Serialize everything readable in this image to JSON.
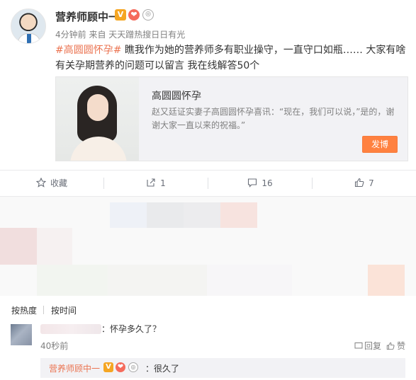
{
  "post": {
    "username": "营养师顾中一",
    "badge_v": "V",
    "meta": "4分钟前 来自 天天蹭热搜日日有光",
    "hashtag": "#高圆圆怀孕#",
    "text": " 瞧我作为她的营养师多有职业操守，一直守口如瓶……    大家有啥有关孕期营养的问题可以留言 我在线解答50个"
  },
  "card": {
    "title": "高圆圆怀孕",
    "description": "赵又廷证实妻子高圆圆怀孕喜讯：“现在，我们可以说，”是的，谢谢大家一直以来的祝福。”",
    "button": "发博"
  },
  "actions": {
    "favorite": "收藏",
    "share_count": "1",
    "comment_count": "16",
    "like_count": "7"
  },
  "sort": {
    "by_hot": "按热度",
    "by_time": "按时间"
  },
  "comment": {
    "text": "：怀孕多久了？",
    "time": "40秒前",
    "report": "回复",
    "like": "赞",
    "reply_user": "营养师顾中一",
    "reply_text": "：很久了"
  },
  "colors": {
    "accent": "#eb7350",
    "button": "#ff8140",
    "vip_badge": "#f5a623"
  }
}
